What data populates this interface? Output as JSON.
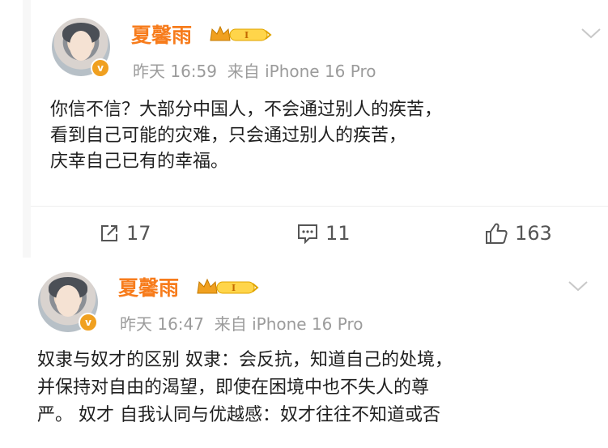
{
  "posts": [
    {
      "author": "夏馨雨",
      "level_badge": "I",
      "time": "昨天 16:59",
      "source": "来自 iPhone 16 Pro",
      "lines": [
        "你信不信？大部分中国人，不会通过别人的疾苦，",
        "看到自己可能的灾难，只会通过别人的疾苦，",
        "庆幸自己已有的幸福。"
      ],
      "actions": {
        "share": "17",
        "comment": "11",
        "like": "163"
      }
    },
    {
      "author": "夏馨雨",
      "level_badge": "I",
      "time": "昨天 16:47",
      "source": "来自 iPhone 16 Pro",
      "lines": [
        "奴隶与奴才的区别 奴隶：会反抗，知道自己的处境，",
        "并保持对自由的渴望，即使在困境中也不失人的尊",
        "严。 奴才 自我认同与优越感：奴才往往不知道或否"
      ]
    }
  ],
  "colors": {
    "author": "#f77c1c",
    "meta": "#9b9b9b",
    "text": "#1f1f1f",
    "badge": "#f0a020"
  },
  "icons": [
    "verified-badge-icon",
    "crown-level-icon",
    "chevron-down-icon",
    "share-icon",
    "comment-icon",
    "like-icon"
  ]
}
